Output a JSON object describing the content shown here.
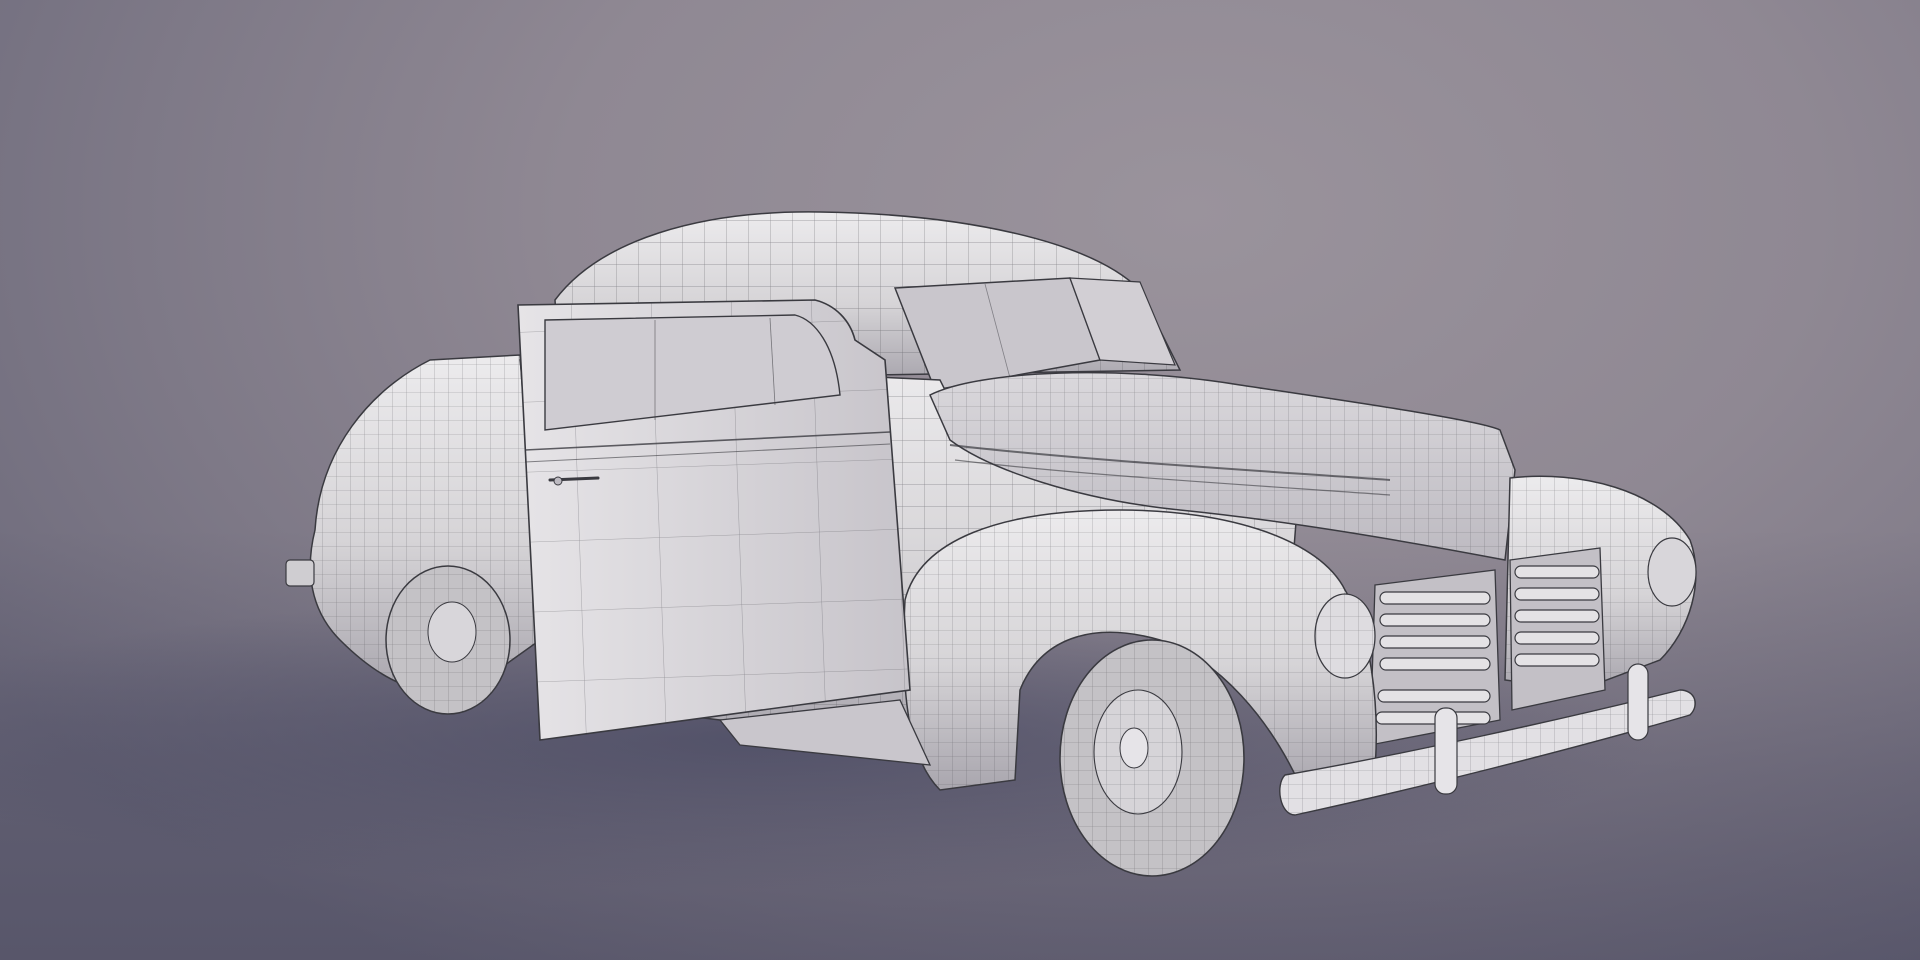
{
  "scene": {
    "subject": "wireframe-car-render",
    "colors": {
      "background": "#8f8893",
      "floor_shadow": "#5d5e7a",
      "body": "#d6d4d7",
      "body_highlight": "#ecebed",
      "body_shade": "#a9a6ae",
      "wire": "#3a3a40",
      "glass": "#c9c6cc",
      "tire": "#c4c2c6"
    }
  }
}
